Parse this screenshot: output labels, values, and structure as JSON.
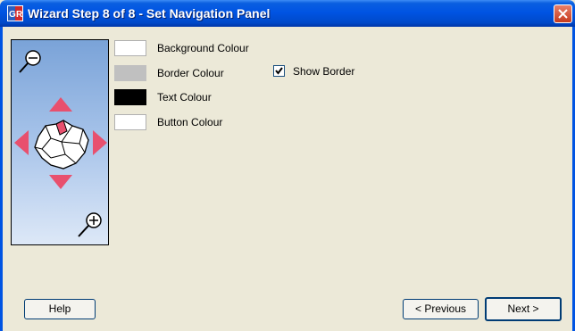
{
  "window": {
    "title": "Wizard Step 8 of 8 - Set Navigation Panel",
    "logo_icon": "gr-logo-icon",
    "close_icon": "close-icon"
  },
  "colours": [
    {
      "label": "Background Colour",
      "color": "#ffffff"
    },
    {
      "label": "Border Colour",
      "color": "#c0c0c0"
    },
    {
      "label": "Text Colour",
      "color": "#000000"
    },
    {
      "label": "Button Colour",
      "color": "#ffffff"
    }
  ],
  "show_border": {
    "label": "Show Border",
    "checked": true
  },
  "preview": {
    "zoom_out_icon": "zoom-out-icon",
    "zoom_in_icon": "zoom-in-icon",
    "arrow_color": "#e8506e",
    "map_icon": "region-map-icon"
  },
  "buttons": {
    "help": "Help",
    "previous": "< Previous",
    "next": "Next >"
  }
}
